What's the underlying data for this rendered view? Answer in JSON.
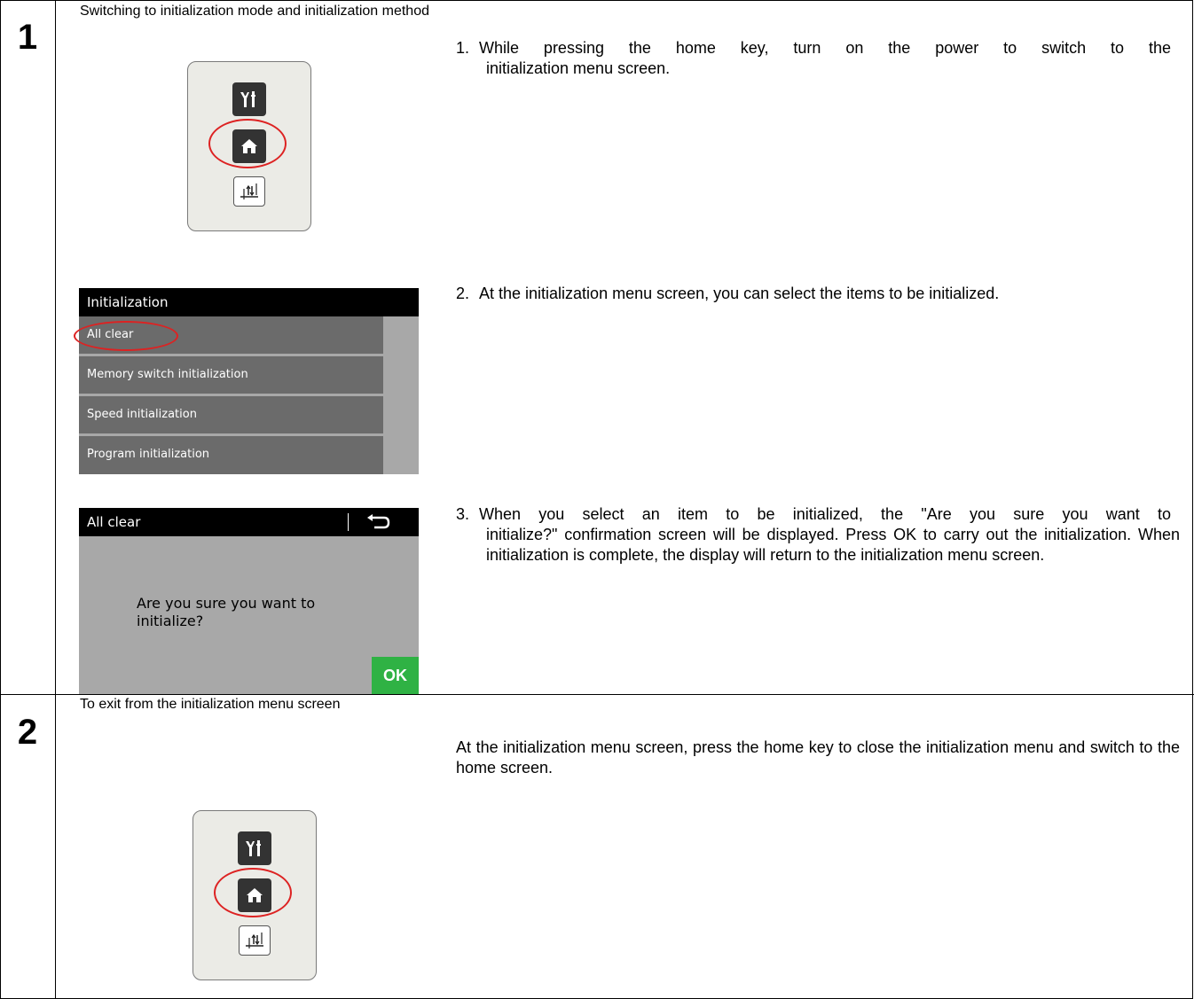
{
  "step1": {
    "number": "1",
    "title": "Switching to initialization mode and initialization method",
    "instructions": [
      {
        "num": "1.",
        "text_first": "While pressing the home key, turn on the power to switch to the",
        "text_rest": "initialization menu screen."
      },
      {
        "num": "2.",
        "text_first": "At the initialization menu screen, you can select the items to be initialized.",
        "text_rest": ""
      },
      {
        "num": "3.",
        "text_first": "When you select an item to be initialized, the \"Are you sure you want to",
        "text_rest": "initialize?\" confirmation screen will be displayed. Press OK to carry out the initialization. When initialization is complete, the display will return to the initialization menu screen."
      }
    ],
    "menu_screen": {
      "title": "Initialization",
      "items": [
        "All clear",
        "Memory switch initialization",
        "Speed initialization",
        "Program initialization"
      ]
    },
    "confirm_screen": {
      "title": "All clear",
      "back_icon": "return-arrow-icon",
      "message_line1": "Are you sure you want to",
      "message_line2": "initialize?",
      "ok_label": "OK"
    }
  },
  "step2": {
    "number": "2",
    "title": "To exit from the initialization menu screen",
    "text": "At the initialization menu screen, press the home key to close the initialization menu and switch to the home screen."
  },
  "key_icons": [
    "settings-tools-icon",
    "home-icon",
    "threading-icon"
  ],
  "colors": {
    "highlight_ring": "#dd2222",
    "ok_button": "#2fb244"
  }
}
